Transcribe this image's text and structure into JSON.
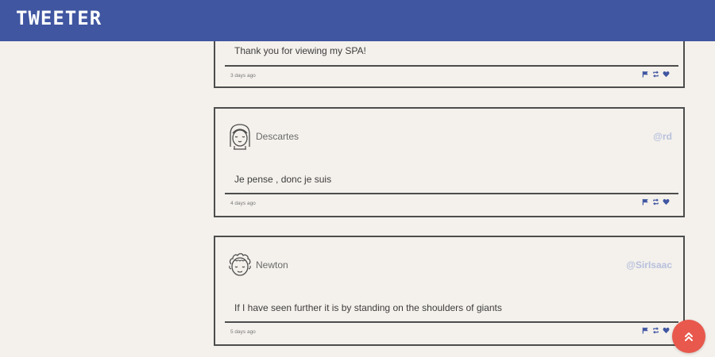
{
  "header": {
    "brand": "TWEETER",
    "background": "#4056a1"
  },
  "tweets": [
    {
      "name": "",
      "handle": "",
      "avatar_icon": "",
      "text": "Thank you for viewing my SPA!",
      "time": "3 days ago",
      "actions": [
        "flag-icon",
        "retweet-icon",
        "heart-icon"
      ]
    },
    {
      "name": "Descartes",
      "handle": "@rd",
      "avatar_icon": "avatar-girl-icon",
      "text": "Je pense , donc je suis",
      "time": "4 days ago",
      "actions": [
        "flag-icon",
        "retweet-icon",
        "heart-icon"
      ]
    },
    {
      "name": "Newton",
      "handle": "@SirIsaac",
      "avatar_icon": "avatar-curly-hair-icon",
      "text": "If I have seen further it is by standing on the shoulders of giants",
      "time": "5 days ago",
      "actions": [
        "flag-icon",
        "retweet-icon",
        "heart-icon"
      ]
    }
  ],
  "scroll_top": {
    "icon": "double-chevron-up-icon",
    "color": "#e8584c"
  },
  "colors": {
    "accent": "#4056a1",
    "handle": "#b7c0dc",
    "page_bg": "#f4f1ec"
  }
}
